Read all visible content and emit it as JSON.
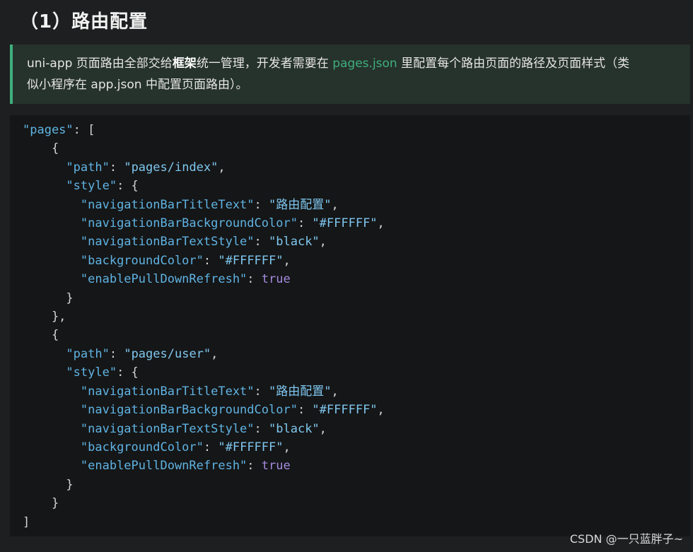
{
  "heading": "（1）路由配置",
  "note": {
    "part1": "uni-app 页面路由全部交给",
    "strong": "框架",
    "part2": "统一管理，开发者需要在 ",
    "accent": "pages.json",
    "part3": " 里配置每个路由页面的路径及页面样式（类",
    "line2": "似小程序在 app.json 中配置页面路由）。"
  },
  "code": {
    "root_key": "\"pages\"",
    "pages": [
      {
        "path_key": "\"path\"",
        "path_value": "\"pages/index\"",
        "style_key": "\"style\"",
        "props": [
          {
            "key": "\"navigationBarTitleText\"",
            "value": "\"路由配置\"",
            "type": "string",
            "comma": ","
          },
          {
            "key": "\"navigationBarBackgroundColor\"",
            "value": "\"#FFFFFF\"",
            "type": "string",
            "comma": ","
          },
          {
            "key": "\"navigationBarTextStyle\"",
            "value": "\"black\"",
            "type": "string",
            "comma": ","
          },
          {
            "key": "\"backgroundColor\"",
            "value": "\"#FFFFFF\"",
            "type": "string",
            "comma": ","
          },
          {
            "key": "\"enablePullDownRefresh\"",
            "value": "true",
            "type": "bool",
            "comma": ""
          }
        ]
      },
      {
        "path_key": "\"path\"",
        "path_value": "\"pages/user\"",
        "style_key": "\"style\"",
        "props": [
          {
            "key": "\"navigationBarTitleText\"",
            "value": "\"路由配置\"",
            "type": "string",
            "comma": ","
          },
          {
            "key": "\"navigationBarBackgroundColor\"",
            "value": "\"#FFFFFF\"",
            "type": "string",
            "comma": ","
          },
          {
            "key": "\"navigationBarTextStyle\"",
            "value": "\"black\"",
            "type": "string",
            "comma": ","
          },
          {
            "key": "\"backgroundColor\"",
            "value": "\"#FFFFFF\"",
            "type": "string",
            "comma": ","
          },
          {
            "key": "\"enablePullDownRefresh\"",
            "value": "true",
            "type": "bool",
            "comma": ""
          }
        ]
      }
    ]
  },
  "watermark": "CSDN @一只蓝胖子~",
  "colors": {
    "background": "#1e1f20",
    "accent": "#3eaf7c",
    "key": "#5fb3e3",
    "string": "#7fc7ef",
    "boolean": "#a48be0"
  }
}
